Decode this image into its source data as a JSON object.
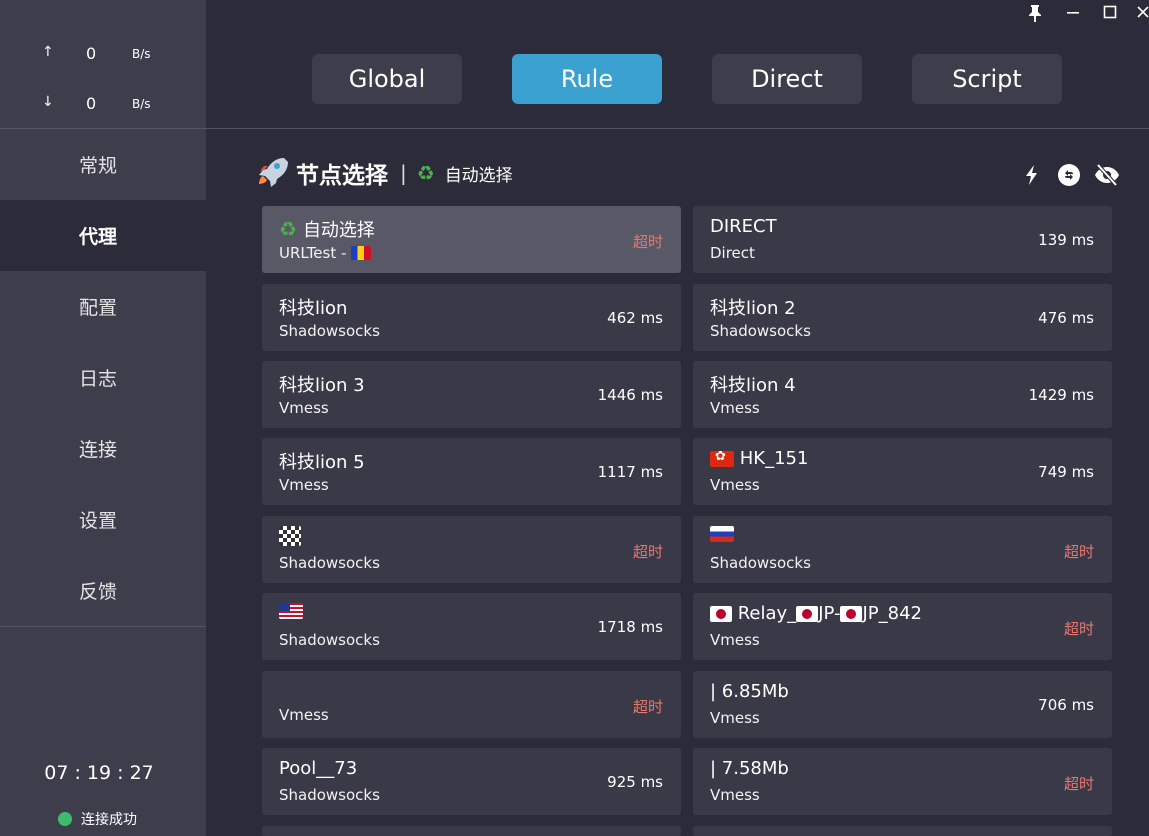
{
  "traffic": {
    "up": {
      "arrow": "↑",
      "value": "0",
      "unit": "B/s"
    },
    "down": {
      "arrow": "↓",
      "value": "0",
      "unit": "B/s"
    }
  },
  "nav": [
    {
      "label": "常规"
    },
    {
      "label": "代理"
    },
    {
      "label": "配置"
    },
    {
      "label": "日志"
    },
    {
      "label": "连接"
    },
    {
      "label": "设置"
    },
    {
      "label": "反馈"
    }
  ],
  "clock": "07 : 19 : 27",
  "status": {
    "label": "连接成功",
    "color": "#3ebc6e"
  },
  "window": {
    "pin": "📌",
    "minimize": "—",
    "maximize": "☐",
    "close": "✕"
  },
  "modes": [
    {
      "label": "Global"
    },
    {
      "label": "Rule"
    },
    {
      "label": "Direct"
    },
    {
      "label": "Script"
    }
  ],
  "active_mode": "Rule",
  "group": {
    "title": "节点选择",
    "separator": "|",
    "selected": "自动选择",
    "icons": [
      "lightning-icon",
      "refresh-icon",
      "eye-off-icon"
    ]
  },
  "proxies": [
    {
      "name": "自动选择",
      "type": "URLTest -",
      "delay": "超时"
    },
    {
      "name": "DIRECT",
      "type": "Direct",
      "delay": "139 ms"
    },
    {
      "name": "科技lion",
      "type": "Shadowsocks",
      "delay": "462 ms"
    },
    {
      "name": "科技lion 2",
      "type": "Shadowsocks",
      "delay": "476 ms"
    },
    {
      "name": "科技lion 3",
      "type": "Vmess",
      "delay": "1446 ms"
    },
    {
      "name": "科技lion 4",
      "type": "Vmess",
      "delay": "1429 ms"
    },
    {
      "name": "科技lion 5",
      "type": "Vmess",
      "delay": "1117 ms"
    },
    {
      "name": "HK_151",
      "type": "Vmess",
      "delay": "749 ms"
    },
    {
      "name": "",
      "type": "Shadowsocks",
      "delay": "超时"
    },
    {
      "name": "",
      "type": "Shadowsocks",
      "delay": "超时"
    },
    {
      "name": "",
      "type": "Shadowsocks",
      "delay": "1718 ms"
    },
    {
      "name_parts": [
        "Relay_",
        "JP-",
        "JP_842"
      ],
      "type": "Vmess",
      "delay": "超时"
    },
    {
      "name": "",
      "type": "Vmess",
      "delay": "超时"
    },
    {
      "name": "| 6.85Mb",
      "type": "Vmess",
      "delay": "706 ms"
    },
    {
      "name": "Pool__73",
      "type": "Shadowsocks",
      "delay": "925 ms"
    },
    {
      "name": "| 7.58Mb",
      "type": "Vmess",
      "delay": "超时"
    }
  ],
  "colors": {
    "accent": "#3aa0cf",
    "timeout": "#e8786e",
    "sidebar": "#3e3d4c",
    "background": "#2c2b3a",
    "card": "#3a3948",
    "card_selected": "#595866"
  }
}
